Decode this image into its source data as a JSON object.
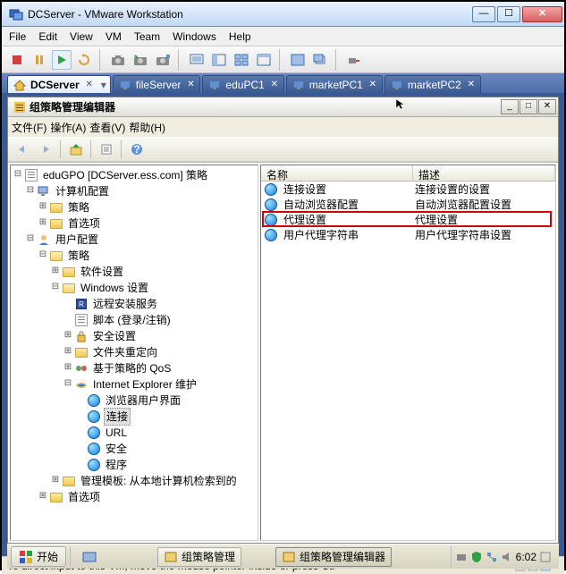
{
  "vmware": {
    "title": "DCServer - VMware Workstation",
    "menu": [
      "File",
      "Edit",
      "View",
      "VM",
      "Team",
      "Windows",
      "Help"
    ],
    "tabs": [
      {
        "label": "DCServer",
        "icon": "home",
        "active": true
      },
      {
        "label": "fileServer",
        "icon": "vm"
      },
      {
        "label": "eduPC1",
        "icon": "vm"
      },
      {
        "label": "marketPC1",
        "icon": "vm"
      },
      {
        "label": "marketPC2",
        "icon": "vm"
      }
    ]
  },
  "mmc": {
    "title": "组策略管理编辑器",
    "menu": {
      "file": "文件(F)",
      "action": "操作(A)",
      "view": "查看(V)",
      "help": "帮助(H)"
    },
    "tree": {
      "root": "eduGPO [DCServer.ess.com] 策略",
      "computer_cfg": "计算机配置",
      "policies": "策略",
      "prefs": "首选项",
      "user_cfg": "用户配置",
      "policies2": "策略",
      "sw_settings": "软件设置",
      "win_settings": "Windows 设置",
      "rds": "远程安装服务",
      "scripts": "脚本 (登录/注销)",
      "sec_settings": "安全设置",
      "folder_redir": "文件夹重定向",
      "qos": "基于策略的 QoS",
      "ie_maint": "Internet Explorer 维护",
      "browser_ui": "浏览器用户界面",
      "connection": "连接",
      "url": "URL",
      "security": "安全",
      "programs": "程序",
      "admin_tmpl": "管理模板: 从本地计算机检索到的",
      "prefs2": "首选项"
    },
    "list": {
      "col_name": "名称",
      "col_desc": "描述",
      "rows": [
        {
          "name": "连接设置",
          "desc": "连接设置的设置"
        },
        {
          "name": "自动浏览器配置",
          "desc": "自动浏览器配置设置"
        },
        {
          "name": "代理设置",
          "desc": "代理设置"
        },
        {
          "name": "用户代理字符串",
          "desc": "用户代理字符串设置"
        }
      ]
    }
  },
  "taskbar": {
    "start": "开始",
    "tasks": [
      {
        "label": "组策略管理",
        "active": false
      },
      {
        "label": "组策略管理编辑器",
        "active": true
      }
    ],
    "clock": "6:02"
  },
  "status": "To direct input to this VM, move the mouse pointer inside or press Ctr"
}
